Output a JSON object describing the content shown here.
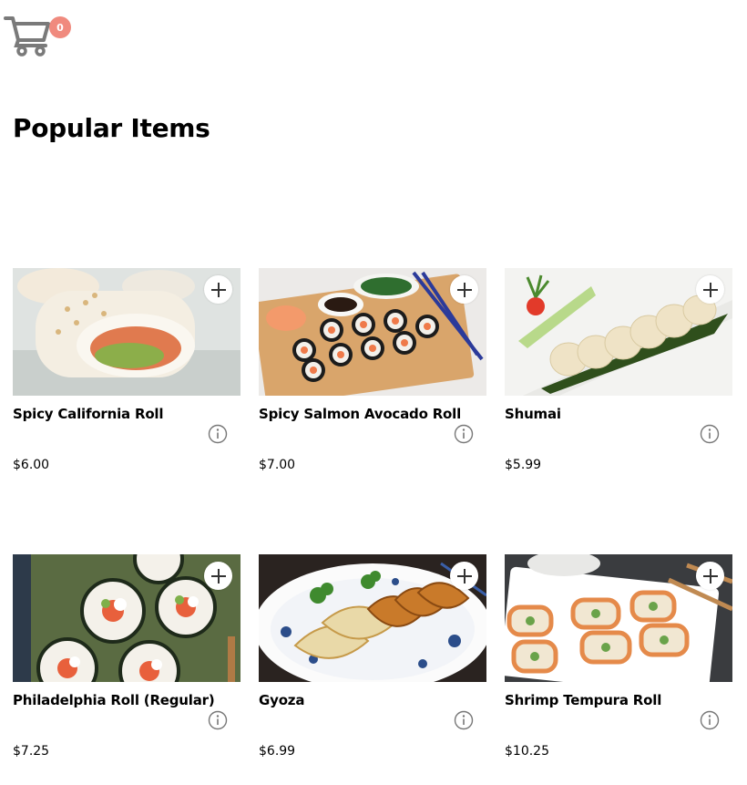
{
  "cart": {
    "count": "0",
    "icon": "cart-icon",
    "badge_color": "#f08a7e"
  },
  "page": {
    "title": "Popular Items"
  },
  "items": [
    {
      "name": "Spicy California Roll",
      "price": "$6.00"
    },
    {
      "name": "Spicy Salmon Avocado Roll",
      "price": "$7.00"
    },
    {
      "name": "Shumai",
      "price": "$5.99"
    },
    {
      "name": "Philadelphia Roll (Regular)",
      "price": "$7.25"
    },
    {
      "name": "Gyoza",
      "price": "$6.99"
    },
    {
      "name": "Shrimp Tempura Roll",
      "price": "$10.25"
    }
  ],
  "icons": {
    "add": "plus-icon",
    "info": "info-icon"
  }
}
